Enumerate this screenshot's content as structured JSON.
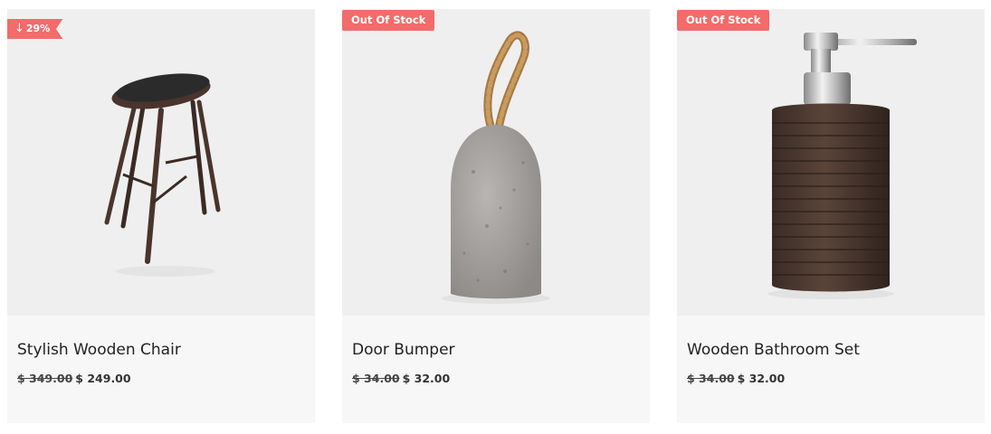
{
  "products": [
    {
      "name": "Stylish Wooden Chair",
      "badge": "29%",
      "badge_icon": "down-arrow-icon",
      "currency": "$",
      "old_price": "$ 349.00",
      "new_price": "$ 249.00"
    },
    {
      "name": "Door Bumper",
      "badge": "Out Of Stock",
      "currency": "$",
      "old_price": "$ 34.00",
      "new_price": "$ 32.00"
    },
    {
      "name": "Wooden Bathroom Set",
      "badge": "Out Of Stock",
      "currency": "$",
      "old_price": "$ 34.00",
      "new_price": "$ 32.00"
    }
  ],
  "colors": {
    "badge": "#f36b6b",
    "card_bg": "#f7f7f7",
    "image_bg": "#efefef",
    "text": "#222222"
  }
}
